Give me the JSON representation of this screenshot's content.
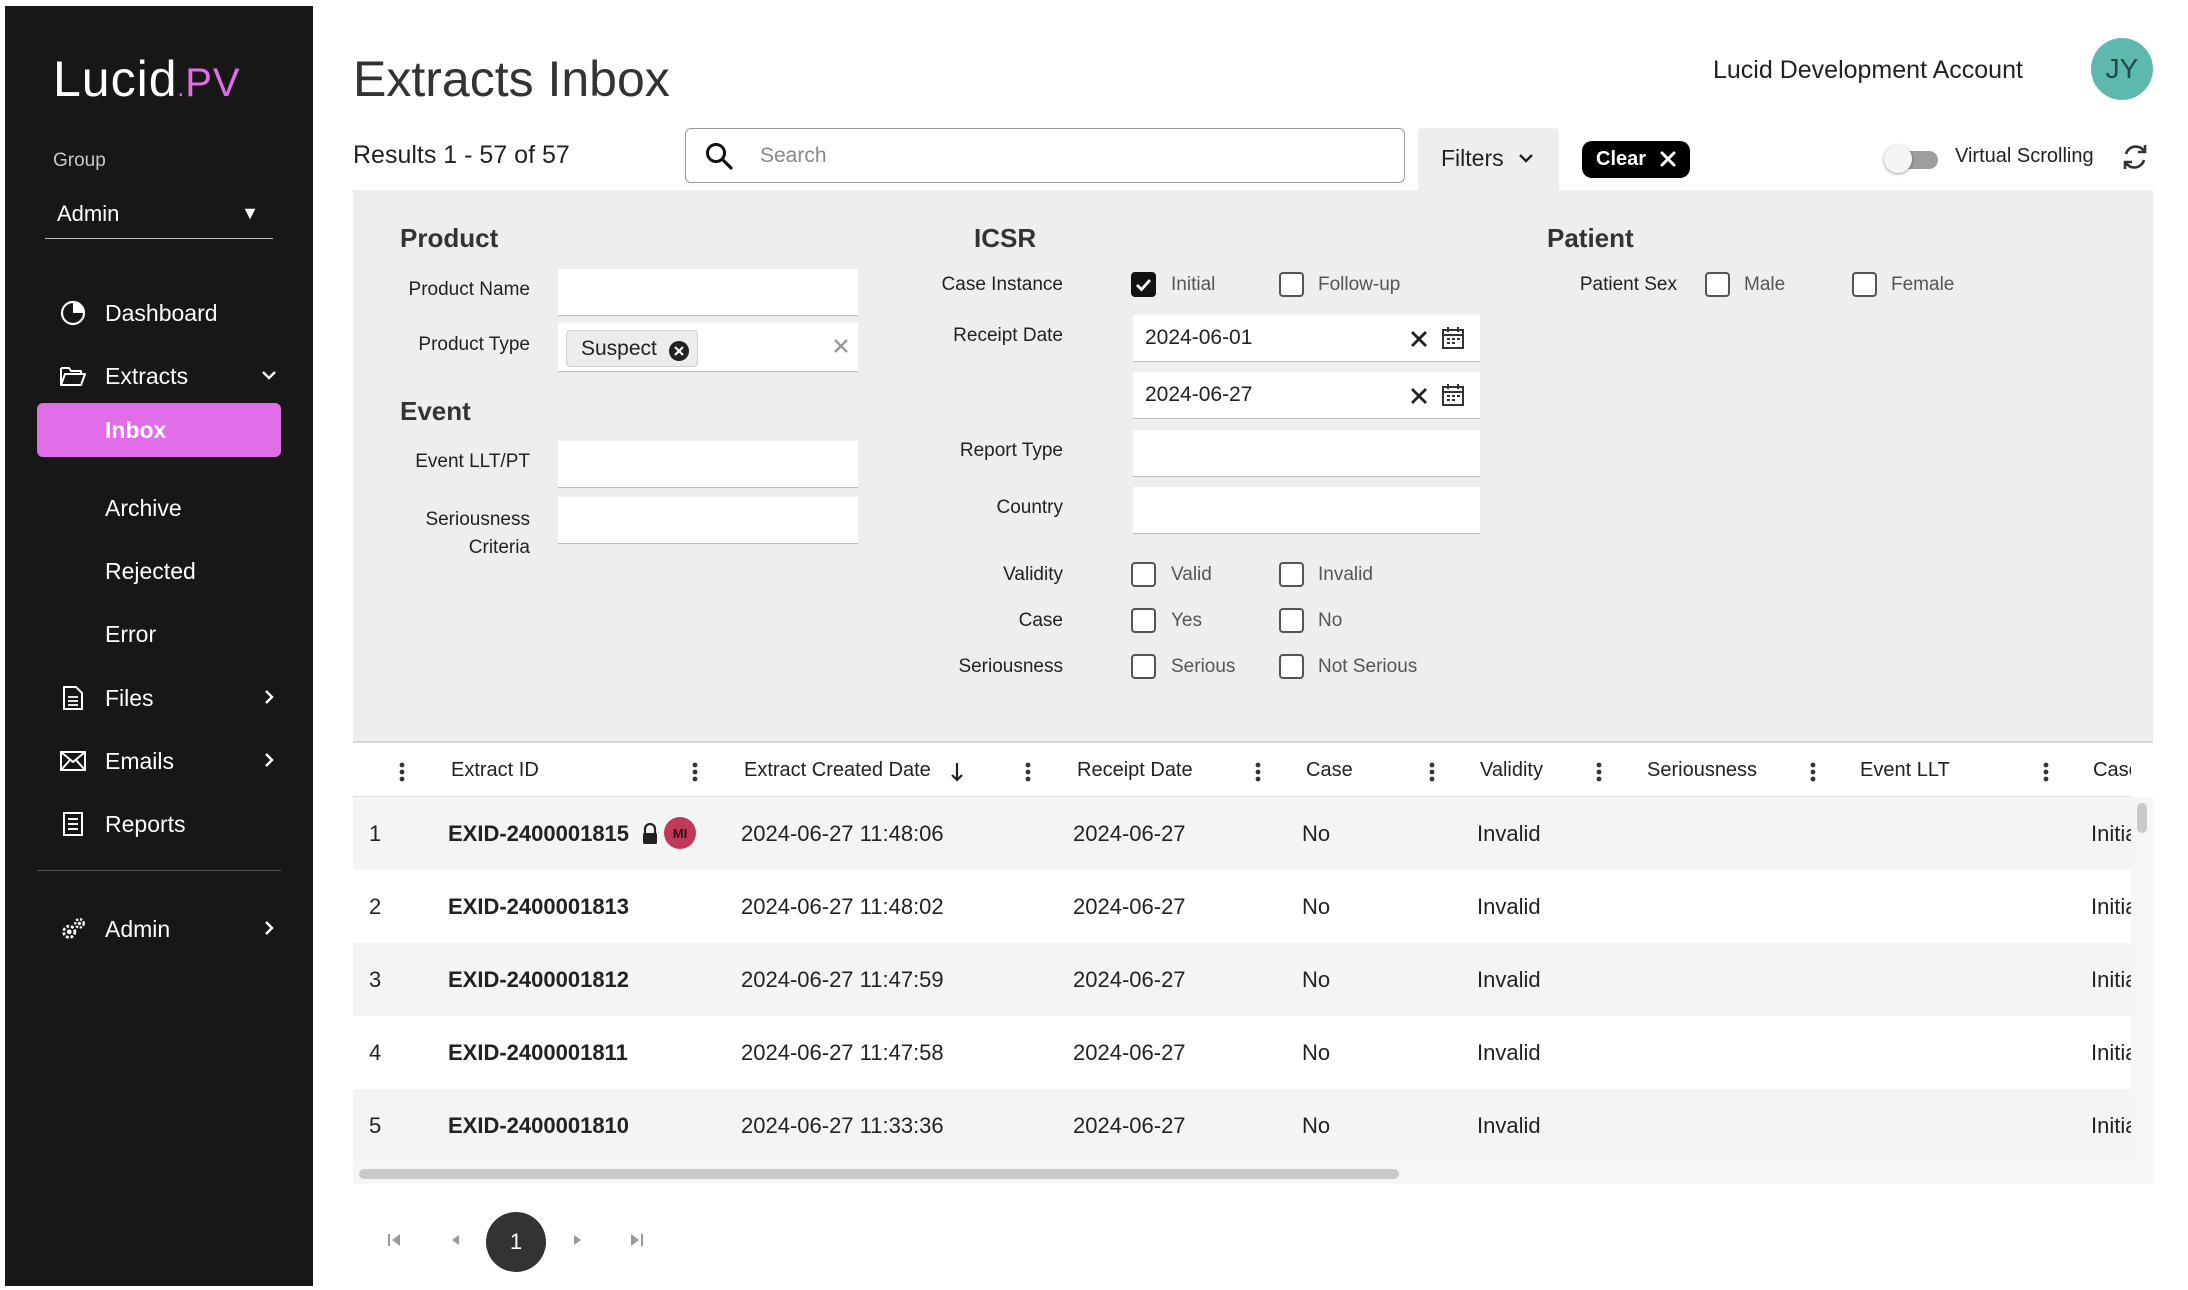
{
  "app": {
    "logo_main": "Lucid",
    "logo_dot": ".",
    "logo_suffix": "PV"
  },
  "sidebar": {
    "group_label": "Group",
    "group_value": "Admin",
    "items": [
      {
        "label": "Dashboard",
        "icon": "pie-chart-icon"
      },
      {
        "label": "Extracts",
        "icon": "folder-open-icon"
      },
      {
        "label": "Files",
        "icon": "document-icon"
      },
      {
        "label": "Emails",
        "icon": "envelope-icon"
      },
      {
        "label": "Reports",
        "icon": "report-icon"
      },
      {
        "label": "Admin",
        "icon": "gears-icon"
      }
    ],
    "extracts_children": [
      "Inbox",
      "Archive",
      "Rejected",
      "Error"
    ],
    "active_item": "Inbox",
    "accent": "#e26de9"
  },
  "header": {
    "title": "Extracts Inbox",
    "account_name": "Lucid Development Account",
    "avatar_initials": "JY",
    "avatar_color": "#5fb8ae"
  },
  "toolbar": {
    "results": "Results 1 - 57 of 57",
    "search_placeholder": "Search",
    "filters_label": "Filters",
    "clear_label": "Clear",
    "virtual_scrolling_label": "Virtual Scrolling",
    "virtual_scrolling_on": false
  },
  "filters": {
    "product": {
      "title": "Product",
      "product_name_label": "Product Name",
      "product_type_label": "Product Type",
      "product_type_chip": "Suspect"
    },
    "event": {
      "title": "Event",
      "event_llt_label": "Event LLT/PT",
      "seriousness_label_1": "Seriousness",
      "seriousness_label_2": "Criteria"
    },
    "icsr": {
      "title": "ICSR",
      "case_instance_label": "Case Instance",
      "initial_label": "Initial",
      "initial_checked": true,
      "followup_label": "Follow-up",
      "followup_checked": false,
      "receipt_date_label": "Receipt Date",
      "receipt_date_from": "2024-06-01",
      "receipt_date_to": "2024-06-27",
      "report_type_label": "Report Type",
      "country_label": "Country",
      "validity_label": "Validity",
      "valid_label": "Valid",
      "invalid_label": "Invalid",
      "case_label": "Case",
      "yes_label": "Yes",
      "no_label": "No",
      "seriousness_label": "Seriousness",
      "serious_label": "Serious",
      "not_serious_label": "Not Serious"
    },
    "patient": {
      "title": "Patient",
      "sex_label": "Patient Sex",
      "male_label": "Male",
      "female_label": "Female"
    }
  },
  "grid": {
    "columns": [
      "Extract ID",
      "Extract Created Date",
      "Receipt Date",
      "Case",
      "Validity",
      "Seriousness",
      "Event LLT",
      "Case"
    ],
    "sort_column": "Extract Created Date",
    "sort_direction": "desc",
    "rows": [
      {
        "num": "1",
        "id": "EXID-2400001815",
        "created": "2024-06-27 11:48:06",
        "receipt": "2024-06-27",
        "case": "No",
        "validity": "Invalid",
        "seriousness": "",
        "event_llt": "",
        "case_instance": "Initial",
        "locked": true,
        "badge": "MI"
      },
      {
        "num": "2",
        "id": "EXID-2400001813",
        "created": "2024-06-27 11:48:02",
        "receipt": "2024-06-27",
        "case": "No",
        "validity": "Invalid",
        "seriousness": "",
        "event_llt": "",
        "case_instance": "Initial"
      },
      {
        "num": "3",
        "id": "EXID-2400001812",
        "created": "2024-06-27 11:47:59",
        "receipt": "2024-06-27",
        "case": "No",
        "validity": "Invalid",
        "seriousness": "",
        "event_llt": "",
        "case_instance": "Initial"
      },
      {
        "num": "4",
        "id": "EXID-2400001811",
        "created": "2024-06-27 11:47:58",
        "receipt": "2024-06-27",
        "case": "No",
        "validity": "Invalid",
        "seriousness": "",
        "event_llt": "",
        "case_instance": "Initial"
      },
      {
        "num": "5",
        "id": "EXID-2400001810",
        "created": "2024-06-27 11:33:36",
        "receipt": "2024-06-27",
        "case": "No",
        "validity": "Invalid",
        "seriousness": "",
        "event_llt": "",
        "case_instance": "Initial"
      }
    ],
    "badge_color": "#c0395a"
  },
  "pager": {
    "current_page": "1"
  }
}
